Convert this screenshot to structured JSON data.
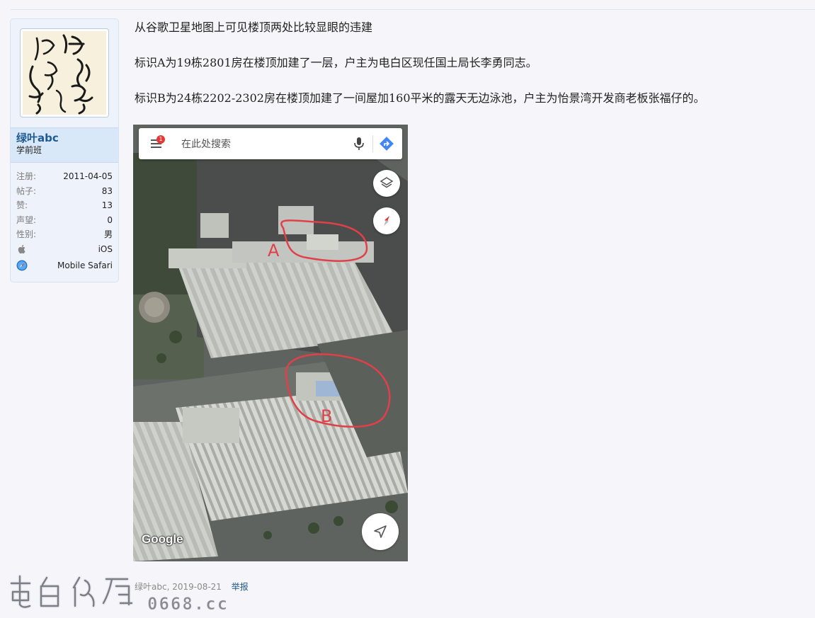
{
  "user": {
    "name": "绿叶abc",
    "title": "学前班",
    "stats": [
      {
        "label": "注册:",
        "value": "2011-04-05"
      },
      {
        "label": "帖子:",
        "value": "83"
      },
      {
        "label": "赞:",
        "value": "13"
      },
      {
        "label": "声望:",
        "value": "0"
      },
      {
        "label": "性别:",
        "value": "男"
      }
    ],
    "os": {
      "icon": "apple-icon",
      "value": "iOS"
    },
    "browser": {
      "icon": "safari-icon",
      "value": "Mobile Safari"
    }
  },
  "post": {
    "paragraphs": [
      "从谷歌卫星地图上可见楼顶两处比较显眼的违建",
      "标识A为19栋2801房在楼顶加建了一层，户主为电白区现任国土局长李勇同志。",
      "标识B为24栋2202-2302房在楼顶加建了一间屋加160平米的露天无边泳池，户主为怡景湾开发商老板张福仔的。"
    ],
    "author_date": "绿叶abc, 2019-08-21",
    "report_label": "举报"
  },
  "map_screenshot": {
    "search_placeholder": "在此处搜索",
    "notification_count": "1",
    "label_a": "A",
    "label_b": "B",
    "google_logo": "Google"
  },
  "watermark": {
    "text": "电白论坛",
    "site": "0668.cc"
  },
  "colors": {
    "link": "#1d5a91",
    "circle": "#e0404a",
    "card_bg": "#eef3fb"
  }
}
